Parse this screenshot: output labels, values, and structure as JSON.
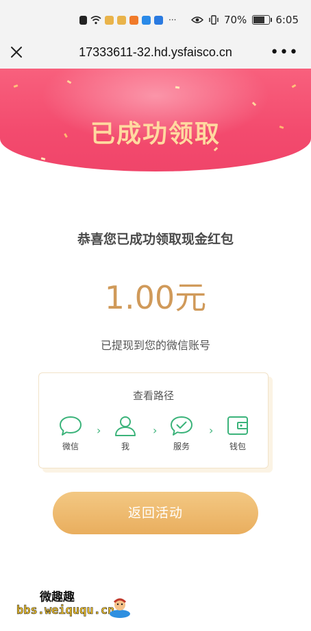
{
  "status_bar": {
    "battery": "70%",
    "time": "6:05",
    "battery_level": 0.7,
    "left_icons": [
      "alert-icon",
      "wifi-icon",
      "app-icon-1",
      "app-icon-2",
      "app-icon-3",
      "app-icon-4",
      "app-icon-5",
      "more-notifications-icon"
    ],
    "right_icons": [
      "eye-icon",
      "vibrate-icon",
      "battery-icon"
    ]
  },
  "nav": {
    "url": "17333611-32.hd.ysfaisco.cn",
    "close_icon": "close-icon",
    "more_icon": "more-icon",
    "more_label": "•••"
  },
  "banner": {
    "title": "已成功领取",
    "colors": {
      "top": "#f8607d",
      "bottom": "#f0456a",
      "title": "#ffd9a0"
    }
  },
  "main": {
    "congrats": "恭喜您已成功领取现金红包",
    "amount": "1.00元",
    "desc": "已提现到您的微信账号"
  },
  "path": {
    "title": "查看路径",
    "arrow": "›",
    "steps": [
      {
        "label": "微信",
        "icon": "chat-bubble-icon"
      },
      {
        "label": "我",
        "icon": "user-icon"
      },
      {
        "label": "服务",
        "icon": "check-circle-icon"
      },
      {
        "label": "钱包",
        "icon": "wallet-icon"
      }
    ],
    "accent": "#3bb37a"
  },
  "button": {
    "label": "返回活动",
    "color": "#eab164"
  },
  "watermark": {
    "top": "微趣趣",
    "url": "bbs.weiququ.cn"
  },
  "colors": {
    "amount": "#d09a5a",
    "card_border": "#f1e2c8"
  }
}
